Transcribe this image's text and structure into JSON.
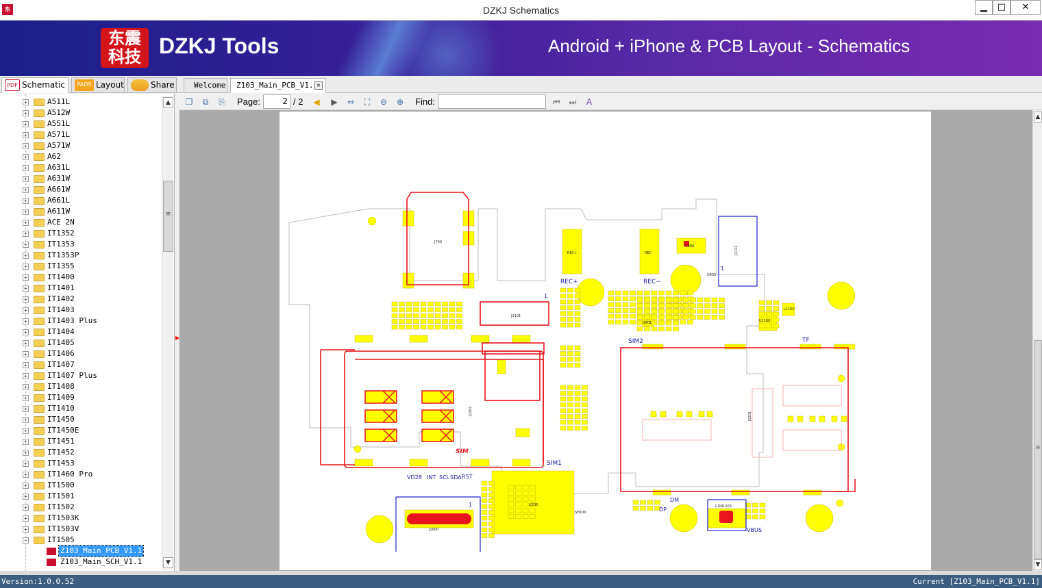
{
  "window": {
    "title": "DZKJ Schematics",
    "minimize": "▁",
    "maximize": "□",
    "close": "✕",
    "app_icon_text": "东"
  },
  "banner": {
    "logo_line1": "东震",
    "logo_line2": "科技",
    "brand": "DZKJ Tools",
    "tagline": "Android + iPhone & PCB Layout - Schematics"
  },
  "tabs": {
    "schematic": "Schematic",
    "layout": "Layout",
    "share": "Share",
    "schematic_icon": "PDF",
    "layout_icon": "PADS"
  },
  "doc_tabs": {
    "welcome": "Welcome",
    "current": "Z103_Main_PCB_V1.1",
    "close": "✕"
  },
  "tree": {
    "folders": [
      "A511L",
      "A512W",
      "A551L",
      "A571L",
      "A571W",
      "A62",
      "A631L",
      "A631W",
      "A661W",
      "A661L",
      "A611W",
      "ACE 2N",
      "IT1352",
      "IT1353",
      "IT1353P",
      "IT1355",
      "IT1400",
      "IT1401",
      "IT1402",
      "IT1403",
      "IT1403 Plus",
      "IT1404",
      "IT1405",
      "IT1406",
      "IT1407",
      "IT1407 Plus",
      "IT1408",
      "IT1409",
      "IT1410",
      "IT1450",
      "IT1450E",
      "IT1451",
      "IT1452",
      "IT1453",
      "IT1460 Pro",
      "IT1500",
      "IT1501",
      "IT1502",
      "IT1503K",
      "IT1503V",
      "IT1505"
    ],
    "files": [
      {
        "label": "Z103_Main_PCB_V1.1",
        "selected": true
      },
      {
        "label": "Z103_Main_SCH_V1.1",
        "selected": false
      }
    ],
    "expanded_folder": "IT1505",
    "expand_glyph": "+",
    "collapse_glyph": "−"
  },
  "toolbar": {
    "page_label": "Page:",
    "page_value": "2",
    "page_total": "/ 2",
    "find_label": "Find:",
    "find_value": ""
  },
  "pcb": {
    "labels": {
      "j700": "J700",
      "rec_plus_pad": "REC+",
      "rec_minus_pad": "REC-",
      "rec_plus": "REC+",
      "rec_minus": "REC−",
      "j1101": "J1101",
      "j1111": "J1111",
      "u900": "U900",
      "u903": "U903",
      "u901": "U901",
      "u1100": "U1100",
      "l1100": "L1100",
      "sim2": "SIM2",
      "tf": "TF",
      "j1202": "J1202",
      "j1201": "J1201",
      "sim1": "SIM1",
      "sim_mark": "SIM",
      "vd28": "VD28",
      "int": "INT",
      "scl": "SCL",
      "sda": "SDA",
      "rst": "RST",
      "j1000": "J1000",
      "u200": "U200",
      "sh100": "SH100",
      "dm": "DM",
      "dp": "DP",
      "con1203": "CON1203",
      "vbus": "VBUS",
      "pin1a": "1",
      "pin1b": "1",
      "pin1c": "1"
    }
  },
  "colors": {
    "accent_yellow": "#ffff00",
    "copper_red": "#e8141e",
    "outline_blue": "#2222cc",
    "label_blue": "#1a1aa8",
    "status_bg": "#3d5e7f"
  },
  "status": {
    "version": "Version:1.0.0.52",
    "current": "Current [Z103_Main_PCB_V1.1]"
  }
}
